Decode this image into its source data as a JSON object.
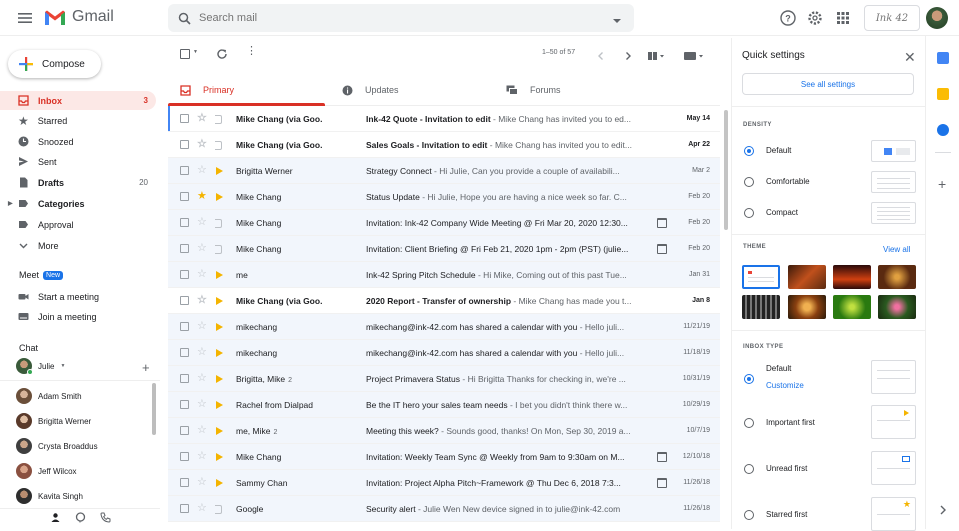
{
  "header": {
    "app_name": "Gmail",
    "search_placeholder": "Search mail",
    "brand_label": "Ink 42"
  },
  "sidebar": {
    "compose_label": "Compose",
    "items": [
      {
        "label": "Inbox",
        "count": "3"
      },
      {
        "label": "Starred",
        "count": ""
      },
      {
        "label": "Snoozed",
        "count": ""
      },
      {
        "label": "Sent",
        "count": ""
      },
      {
        "label": "Drafts",
        "count": "20"
      },
      {
        "label": "Categories",
        "count": ""
      },
      {
        "label": "Approval",
        "count": ""
      },
      {
        "label": "More",
        "count": ""
      }
    ],
    "meet": {
      "title": "Meet",
      "badge": "New",
      "start": "Start a meeting",
      "join": "Join a meeting"
    },
    "chat": {
      "title": "Chat",
      "self": "Julie",
      "contacts": [
        "Adam Smith",
        "Brigitta Werner",
        "Crysta Broaddus",
        "Jeff Wilcox",
        "Kavita Singh"
      ]
    }
  },
  "toolbar": {
    "pager": "1–50 of 57"
  },
  "tabs": [
    {
      "label": "Primary"
    },
    {
      "label": "Updates"
    },
    {
      "label": "Forums"
    }
  ],
  "emails": [
    {
      "sender": "Mike Chang (via Goo.",
      "count": "",
      "subject": "Ink-42 Quote - Invitation to edit",
      "snippet": " - Mike Chang has invited you to ed...",
      "date": "May 14",
      "unread": true,
      "starred": false,
      "important": false,
      "cal": false
    },
    {
      "sender": "Mike Chang (via Goo.",
      "count": "",
      "subject": "Sales Goals - Invitation to edit",
      "snippet": " - Mike Chang has invited you to edit...",
      "date": "Apr 22",
      "unread": true,
      "starred": false,
      "important": false,
      "cal": false
    },
    {
      "sender": "Brigitta Werner",
      "count": "",
      "subject": "Strategy Connect",
      "snippet": " - Hi Julie, Can you provide a couple of availabili...",
      "date": "Mar 2",
      "unread": false,
      "starred": false,
      "important": true,
      "cal": false
    },
    {
      "sender": "Mike Chang",
      "count": "",
      "subject": "Status Update",
      "snippet": " - Hi Julie, Hope you are having a nice week so far. C...",
      "date": "Feb 20",
      "unread": false,
      "starred": true,
      "important": true,
      "cal": false
    },
    {
      "sender": "Mike Chang",
      "count": "",
      "subject": "Invitation: Ink-42 Company Wide Meeting @ Fri Mar 20, 2020 12:30...",
      "snippet": "",
      "date": "Feb 20",
      "unread": false,
      "starred": false,
      "important": false,
      "cal": true
    },
    {
      "sender": "Mike Chang",
      "count": "",
      "subject": "Invitation: Client Briefing @ Fri Feb 21, 2020 1pm - 2pm (PST) (julie...",
      "snippet": "",
      "date": "Feb 20",
      "unread": false,
      "starred": false,
      "important": false,
      "cal": true
    },
    {
      "sender": "me",
      "count": "",
      "subject": "Ink-42 Spring Pitch Schedule",
      "snippet": " - Hi Mike, Coming out of this past Tue...",
      "date": "Jan 31",
      "unread": false,
      "starred": false,
      "important": true,
      "cal": false
    },
    {
      "sender": "Mike Chang (via Goo.",
      "count": "",
      "subject": "2020 Report - Transfer of ownership",
      "snippet": " - Mike Chang has made you t...",
      "date": "Jan 8",
      "unread": true,
      "starred": false,
      "important": true,
      "cal": false
    },
    {
      "sender": "mikechang",
      "count": "",
      "subject": "mikechang@ink-42.com has shared a calendar with you",
      "snippet": " - Hello juli...",
      "date": "11/21/19",
      "unread": false,
      "starred": false,
      "important": true,
      "cal": false
    },
    {
      "sender": "mikechang",
      "count": "",
      "subject": "mikechang@ink-42.com has shared a calendar with you",
      "snippet": " - Hello juli...",
      "date": "11/18/19",
      "unread": false,
      "starred": false,
      "important": true,
      "cal": false
    },
    {
      "sender": "Brigitta, Mike",
      "count": "2",
      "subject": "Project Primavera Status",
      "snippet": " - Hi Brigitta Thanks for checking in, we're ...",
      "date": "10/31/19",
      "unread": false,
      "starred": false,
      "important": true,
      "cal": false
    },
    {
      "sender": "Rachel from Dialpad",
      "count": "",
      "subject": "Be the IT hero your sales team needs",
      "snippet": " - I bet you didn't think there w...",
      "date": "10/29/19",
      "unread": false,
      "starred": false,
      "important": true,
      "cal": false
    },
    {
      "sender": "me, Mike",
      "count": "2",
      "subject": "Meeting this week?",
      "snippet": " - Sounds good, thanks! On Mon, Sep 30, 2019 a...",
      "date": "10/7/19",
      "unread": false,
      "starred": false,
      "important": true,
      "cal": false
    },
    {
      "sender": "Mike Chang",
      "count": "",
      "subject": "Invitation: Weekly Team Sync @ Weekly from 9am to 9:30am on M...",
      "snippet": "",
      "date": "12/10/18",
      "unread": false,
      "starred": false,
      "important": true,
      "cal": true
    },
    {
      "sender": "Sammy Chan",
      "count": "",
      "subject": "Invitation: Project Alpha Pitch~Framework @ Thu Dec 6, 2018 7:3...",
      "snippet": "",
      "date": "11/26/18",
      "unread": false,
      "starred": false,
      "important": true,
      "cal": true
    },
    {
      "sender": "Google",
      "count": "",
      "subject": "Security alert",
      "snippet": " - Julie Wen New device signed in to julie@ink-42.com",
      "date": "11/26/18",
      "unread": false,
      "starred": false,
      "important": false,
      "cal": false
    }
  ],
  "quick_settings": {
    "title": "Quick settings",
    "see_all": "See all settings",
    "density_title": "DENSITY",
    "density_options": [
      "Default",
      "Comfortable",
      "Compact"
    ],
    "theme_title": "THEME",
    "view_all": "View all",
    "inbox_type_title": "INBOX TYPE",
    "inbox_options": [
      "Default",
      "Important first",
      "Unread first",
      "Starred first"
    ],
    "customize": "Customize"
  },
  "colors": {
    "accent_red": "#d93025",
    "accent_blue": "#1a73e8",
    "important_yellow": "#f4b400"
  }
}
